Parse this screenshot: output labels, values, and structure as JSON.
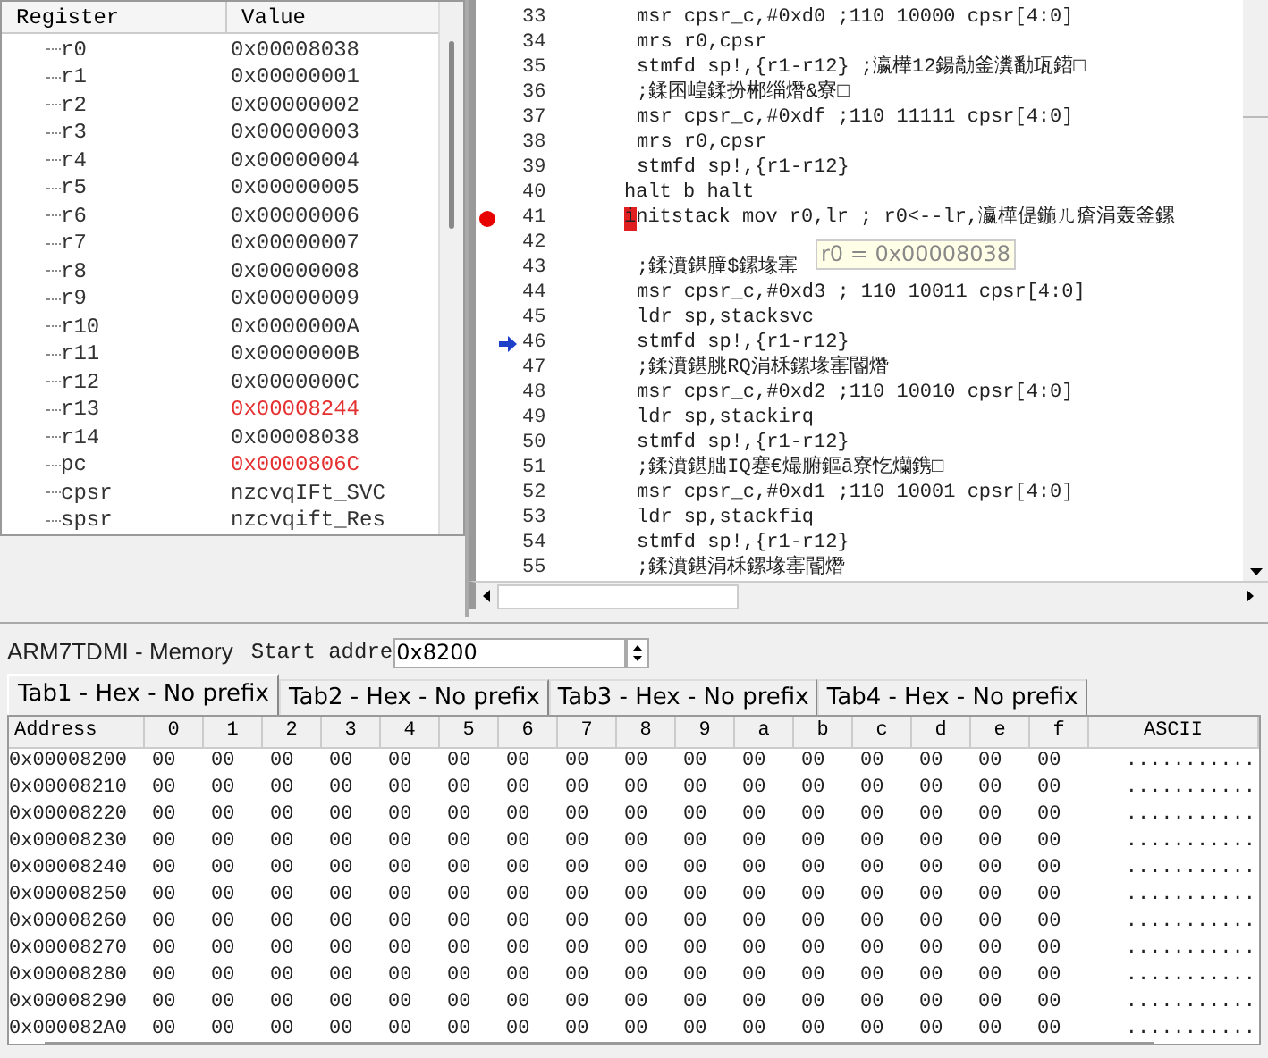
{
  "registers": {
    "columns": [
      "Register",
      "Value"
    ],
    "rows": [
      {
        "name": "r0",
        "value": "0x00008038",
        "changed": false
      },
      {
        "name": "r1",
        "value": "0x00000001",
        "changed": false
      },
      {
        "name": "r2",
        "value": "0x00000002",
        "changed": false
      },
      {
        "name": "r3",
        "value": "0x00000003",
        "changed": false
      },
      {
        "name": "r4",
        "value": "0x00000004",
        "changed": false
      },
      {
        "name": "r5",
        "value": "0x00000005",
        "changed": false
      },
      {
        "name": "r6",
        "value": "0x00000006",
        "changed": false
      },
      {
        "name": "r7",
        "value": "0x00000007",
        "changed": false
      },
      {
        "name": "r8",
        "value": "0x00000008",
        "changed": false
      },
      {
        "name": "r9",
        "value": "0x00000009",
        "changed": false
      },
      {
        "name": "r10",
        "value": "0x0000000A",
        "changed": false
      },
      {
        "name": "r11",
        "value": "0x0000000B",
        "changed": false
      },
      {
        "name": "r12",
        "value": "0x0000000C",
        "changed": false
      },
      {
        "name": "r13",
        "value": "0x00008244",
        "changed": true
      },
      {
        "name": "r14",
        "value": "0x00008038",
        "changed": false
      },
      {
        "name": "pc",
        "value": "0x0000806C",
        "changed": true
      },
      {
        "name": "cpsr",
        "value": "nzcvqIFt_SVC",
        "changed": false
      },
      {
        "name": "spsr",
        "value": "nzcvqift_Res",
        "changed": false
      }
    ]
  },
  "code": {
    "lines": [
      {
        "number": "33",
        "kind": "code",
        "text": "msr cpsr_c,#0xd0   ;110 10000 cpsr[4:0]",
        "breakpoint": false,
        "current": false,
        "cursor": false
      },
      {
        "number": "34",
        "kind": "code",
        "text": "mrs r0,cpsr",
        "breakpoint": false,
        "current": false,
        "cursor": false
      },
      {
        "number": "35",
        "kind": "code",
        "text": "stmfd sp!,{r1-r12} ;瀛樺12鍚勪釜瀵勫瓨鍣□",
        "breakpoint": false,
        "current": false,
        "cursor": false
      },
      {
        "number": "36",
        "kind": "code",
        "text": ";鍒囨崲鍒扮郴缁熸&寮□",
        "breakpoint": false,
        "current": false,
        "cursor": false
      },
      {
        "number": "37",
        "kind": "code",
        "text": "msr cpsr_c,#0xdf   ;110 11111 cpsr[4:0]",
        "breakpoint": false,
        "current": false,
        "cursor": false
      },
      {
        "number": "38",
        "kind": "code",
        "text": "mrs r0,cpsr",
        "breakpoint": false,
        "current": false,
        "cursor": false
      },
      {
        "number": "39",
        "kind": "code",
        "text": "stmfd sp!,{r1-r12}",
        "breakpoint": false,
        "current": false,
        "cursor": false
      },
      {
        "number": "40",
        "kind": "label",
        "text": "halt b halt",
        "breakpoint": false,
        "current": false,
        "cursor": false
      },
      {
        "number": "41",
        "kind": "label",
        "text": "initstack mov r0,lr ; r0<--lr,瀛樺偍鍦ㄦ瘡涓轰釜鏍",
        "breakpoint": true,
        "current": false,
        "cursor": true
      },
      {
        "number": "42",
        "kind": "code",
        "breakpoint": false,
        "current": false,
        "cursor": false
      },
      {
        "number": "43",
        "kind": "code",
        "text": ";鍒濆鍖朣$鏍堟寚",
        "breakpoint": false,
        "current": false,
        "cursor": false
      },
      {
        "number": "44",
        "kind": "code",
        "text": "msr cpsr_c,#0xd3   ; 110 10011 cpsr[4:0]",
        "breakpoint": false,
        "current": false,
        "cursor": false
      },
      {
        "number": "45",
        "kind": "code",
        "text": "ldr sp,stacksvc",
        "breakpoint": false,
        "current": false,
        "cursor": false
      },
      {
        "number": "46",
        "kind": "code",
        "text": "stmfd sp!,{r1-r12}",
        "breakpoint": false,
        "current": true,
        "cursor": false
      },
      {
        "number": "47",
        "kind": "code",
        "text": ";鍒濆鍖朓RQ涓柇鏍堟寚閽熸",
        "breakpoint": false,
        "current": false,
        "cursor": false
      },
      {
        "number": "48",
        "kind": "code",
        "text": "msr cpsr_c,#0xd2   ;110 10010 cpsr[4:0]",
        "breakpoint": false,
        "current": false,
        "cursor": false
      },
      {
        "number": "49",
        "kind": "code",
        "text": "ldr sp,stackirq",
        "breakpoint": false,
        "current": false,
        "cursor": false
      },
      {
        "number": "50",
        "kind": "code",
        "text": "stmfd sp!,{r1-r12}",
        "breakpoint": false,
        "current": false,
        "cursor": false
      },
      {
        "number": "51",
        "kind": "code",
        "text": ";鍒濆鍖朏IQ蹇€熶腑鏂ā寮忔爤鎸□",
        "breakpoint": false,
        "current": false,
        "cursor": false
      },
      {
        "number": "52",
        "kind": "code",
        "text": "msr cpsr_c,#0xd1   ;110 10001 cpsr[4:0]",
        "breakpoint": false,
        "current": false,
        "cursor": false
      },
      {
        "number": "53",
        "kind": "code",
        "text": "ldr sp,stackfiq",
        "breakpoint": false,
        "current": false,
        "cursor": false
      },
      {
        "number": "54",
        "kind": "code",
        "text": "stmfd sp!,{r1-r12}",
        "breakpoint": false,
        "current": false,
        "cursor": false
      },
      {
        "number": "55",
        "kind": "code",
        "text": ";鍒濆鍖涓柇鏍堟寚閽熸",
        "breakpoint": false,
        "current": false,
        "cursor": false
      }
    ],
    "tooltip": "r0 = 0x00008038"
  },
  "memory": {
    "title": "ARM7TDMI - Memory",
    "start_address": {
      "label": "Start addre",
      "value": "0x8200"
    },
    "tabs": [
      {
        "label": "Tab1 - Hex - No prefix",
        "selected": true
      },
      {
        "label": "Tab2 - Hex - No prefix",
        "selected": false
      },
      {
        "label": "Tab3 - Hex - No prefix",
        "selected": false
      },
      {
        "label": "Tab4 - Hex - No prefix",
        "selected": false
      }
    ],
    "columns": [
      "Address",
      "0",
      "1",
      "2",
      "3",
      "4",
      "5",
      "6",
      "7",
      "8",
      "9",
      "a",
      "b",
      "c",
      "d",
      "e",
      "f",
      "ASCII"
    ],
    "rows": [
      {
        "address": "0x00008200",
        "bytes": [
          "00",
          "00",
          "00",
          "00",
          "00",
          "00",
          "00",
          "00",
          "00",
          "00",
          "00",
          "00",
          "00",
          "00",
          "00",
          "00"
        ],
        "ascii": "..........."
      },
      {
        "address": "0x00008210",
        "bytes": [
          "00",
          "00",
          "00",
          "00",
          "00",
          "00",
          "00",
          "00",
          "00",
          "00",
          "00",
          "00",
          "00",
          "00",
          "00",
          "00"
        ],
        "ascii": "..........."
      },
      {
        "address": "0x00008220",
        "bytes": [
          "00",
          "00",
          "00",
          "00",
          "00",
          "00",
          "00",
          "00",
          "00",
          "00",
          "00",
          "00",
          "00",
          "00",
          "00",
          "00"
        ],
        "ascii": "..........."
      },
      {
        "address": "0x00008230",
        "bytes": [
          "00",
          "00",
          "00",
          "00",
          "00",
          "00",
          "00",
          "00",
          "00",
          "00",
          "00",
          "00",
          "00",
          "00",
          "00",
          "00"
        ],
        "ascii": "..........."
      },
      {
        "address": "0x00008240",
        "bytes": [
          "00",
          "00",
          "00",
          "00",
          "00",
          "00",
          "00",
          "00",
          "00",
          "00",
          "00",
          "00",
          "00",
          "00",
          "00",
          "00"
        ],
        "ascii": "..........."
      },
      {
        "address": "0x00008250",
        "bytes": [
          "00",
          "00",
          "00",
          "00",
          "00",
          "00",
          "00",
          "00",
          "00",
          "00",
          "00",
          "00",
          "00",
          "00",
          "00",
          "00"
        ],
        "ascii": "..........."
      },
      {
        "address": "0x00008260",
        "bytes": [
          "00",
          "00",
          "00",
          "00",
          "00",
          "00",
          "00",
          "00",
          "00",
          "00",
          "00",
          "00",
          "00",
          "00",
          "00",
          "00"
        ],
        "ascii": "..........."
      },
      {
        "address": "0x00008270",
        "bytes": [
          "00",
          "00",
          "00",
          "00",
          "00",
          "00",
          "00",
          "00",
          "00",
          "00",
          "00",
          "00",
          "00",
          "00",
          "00",
          "00"
        ],
        "ascii": "..........."
      },
      {
        "address": "0x00008280",
        "bytes": [
          "00",
          "00",
          "00",
          "00",
          "00",
          "00",
          "00",
          "00",
          "00",
          "00",
          "00",
          "00",
          "00",
          "00",
          "00",
          "00"
        ],
        "ascii": "..........."
      },
      {
        "address": "0x00008290",
        "bytes": [
          "00",
          "00",
          "00",
          "00",
          "00",
          "00",
          "00",
          "00",
          "00",
          "00",
          "00",
          "00",
          "00",
          "00",
          "00",
          "00"
        ],
        "ascii": "..........."
      },
      {
        "address": "0x000082A0",
        "bytes": [
          "00",
          "00",
          "00",
          "00",
          "00",
          "00",
          "00",
          "00",
          "00",
          "00",
          "00",
          "00",
          "00",
          "00",
          "00",
          "00"
        ],
        "ascii": "..........."
      }
    ]
  }
}
